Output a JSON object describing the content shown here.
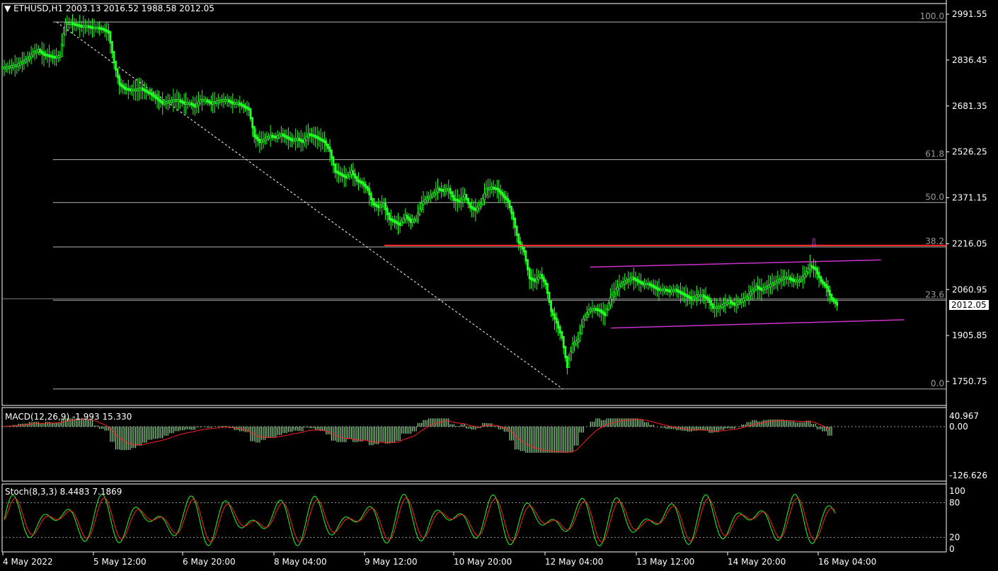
{
  "header": {
    "symbol_line": "ETHUSD,H1  2003.13 2016.52 1988.58 2012.05",
    "current_price": "2012.05"
  },
  "colors": {
    "candle": "#22ff22",
    "resistance": "#ff2a2a",
    "channel": "#cc33cc",
    "macd_hist": "#8fd68f",
    "signal": "#ff2222",
    "stoch_main": "#22ff22",
    "stoch_signal": "#ff2222",
    "fib": "#b4b4b4"
  },
  "indicators": {
    "macd_label": "MACD(12,26,9) -1.993 15.330",
    "stoch_label": "Stoch(8,3,3) 8.4483 7.1869"
  },
  "chart_data": [
    {
      "type": "candlestick",
      "title": "ETHUSD,H1",
      "y_ticks": [
        "2991.55",
        "2836.45",
        "2681.35",
        "2526.25",
        "2371.15",
        "2216.05",
        "2060.95",
        "1905.85",
        "1750.75"
      ],
      "y_tick_values": [
        2991.55,
        2836.45,
        2681.35,
        2526.25,
        2371.15,
        2216.05,
        2060.95,
        1905.85,
        1750.75
      ],
      "x_ticks": [
        "4 May 2022",
        "5 May 12:00",
        "6 May 20:00",
        "8 May 04:00",
        "9 May 12:00",
        "10 May 20:00",
        "12 May 04:00",
        "13 May 12:00",
        "14 May 20:00",
        "16 May 04:00"
      ],
      "fib_levels": [
        {
          "label": "100.0",
          "value": 2965
        },
        {
          "label": "61.8",
          "value": 2500
        },
        {
          "label": "50.0",
          "value": 2355
        },
        {
          "label": "38.2",
          "value": 2205
        },
        {
          "label": "23.6",
          "value": 2025
        },
        {
          "label": "0.0",
          "value": 1725
        }
      ],
      "resistance_level": 2210,
      "close_series": [
        2810,
        2815,
        2818,
        2830,
        2840,
        2860,
        2870,
        2855,
        2850,
        2845,
        2850,
        2960,
        2960,
        2955,
        2950,
        2950,
        2945,
        2945,
        2940,
        2930,
        2830,
        2755,
        2740,
        2735,
        2735,
        2740,
        2730,
        2720,
        2705,
        2690,
        2695,
        2700,
        2700,
        2690,
        2690,
        2680,
        2700,
        2700,
        2690,
        2695,
        2700,
        2700,
        2690,
        2690,
        2680,
        2670,
        2580,
        2560,
        2570,
        2580,
        2575,
        2585,
        2575,
        2565,
        2570,
        2560,
        2585,
        2580,
        2570,
        2560,
        2530,
        2460,
        2450,
        2440,
        2460,
        2430,
        2420,
        2400,
        2350,
        2340,
        2350,
        2300,
        2290,
        2280,
        2310,
        2290,
        2300,
        2350,
        2370,
        2380,
        2400,
        2395,
        2400,
        2365,
        2360,
        2380,
        2340,
        2330,
        2350,
        2400,
        2405,
        2400,
        2380,
        2360,
        2300,
        2220,
        2190,
        2100,
        2090,
        2110,
        2080,
        1990,
        1950,
        1900,
        1800,
        1875,
        1890,
        1960,
        1990,
        1995,
        1990,
        1975,
        2030,
        2060,
        2080,
        2090,
        2100,
        2090,
        2080,
        2080,
        2070,
        2060,
        2060,
        2055,
        2060,
        2050,
        2040,
        2030,
        2040,
        2040,
        2030,
        2000,
        2000,
        2010,
        2020,
        2010,
        2020,
        2030,
        2050,
        2070,
        2060,
        2070,
        2080,
        2090,
        2100,
        2100,
        2090,
        2090,
        2110,
        2140,
        2130,
        2090,
        2070,
        2030,
        2010
      ],
      "channel_upper": {
        "x_from": 0.6217,
        "x_to": 0.9281,
        "y_from": 2137,
        "y_to": 2161
      },
      "channel_lower": {
        "x_from": 0.6437,
        "x_to": 0.9525,
        "y_from": 1931,
        "y_to": 1959
      }
    },
    {
      "type": "histogram",
      "title": "MACD(12,26,9)",
      "y_ticks": [
        "40.967",
        "0.00",
        "-126.626"
      ],
      "y_tick_values": [
        40.967,
        0,
        -126.626
      ]
    },
    {
      "type": "line",
      "title": "Stoch(8,3,3)",
      "y_ticks": [
        "100",
        "80",
        "20",
        "0"
      ],
      "y_tick_values": [
        100,
        80,
        20,
        0
      ]
    }
  ]
}
